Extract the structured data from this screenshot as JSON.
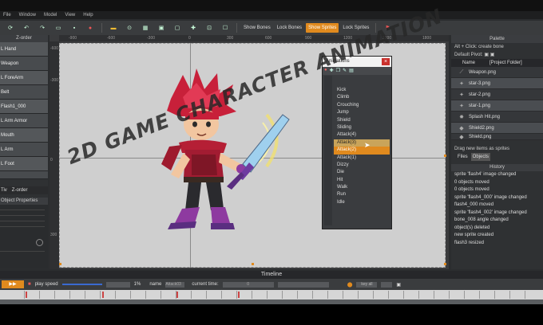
{
  "menubar": [
    "File",
    "Window",
    "Model",
    "View",
    "Help"
  ],
  "toolbar": {
    "show_bones": "Show Bones",
    "lock_bones": "Lock Bones",
    "show_sprites": "Show Sprites",
    "lock_sprites": "Lock Sprites"
  },
  "left_panel": {
    "title": "Z-order",
    "items": [
      "L Hand",
      "Weapon",
      "L ForeArm",
      "Belt",
      "Flash1_000",
      "L Arm Armor",
      "Mouth",
      "L Arm",
      "L Foot",
      ""
    ],
    "tabs": [
      "Tiv",
      "Z-order"
    ],
    "props_title": "Object Properties"
  },
  "ruler": {
    "top": [
      "-900",
      "-600",
      "-300",
      "0",
      "300",
      "600",
      "900",
      "1200",
      "1500",
      "1800"
    ],
    "left": [
      "-600",
      "-300",
      "0",
      "300"
    ]
  },
  "animations": {
    "title": "Animations",
    "items": [
      "Kick",
      "Climb",
      "Crouching",
      "Jump",
      "Shield",
      "Sliding",
      "Attack(4)",
      "Attack(3)",
      "Attack(2)",
      "Attack(1)",
      "Dizzy",
      "Die",
      "Hit",
      "Walk",
      "Run",
      "Idle"
    ]
  },
  "palette": {
    "title": "Palette",
    "hint": "Alt + Click: create bone",
    "default_pivot": "Default Pivot:",
    "col_name": "Name",
    "col_folder": "[Project Folder]",
    "items": [
      "Weapon.png",
      "star-3.png",
      "star-2.png",
      "star-1.png",
      "Splash Hit.png",
      "Shield2.png",
      "Shield.png"
    ],
    "drag_hint": "Drag new items as sprites",
    "tabs": [
      "Files",
      "Objects"
    ]
  },
  "history": {
    "title": "History",
    "items": [
      "sprite 'flash4' image changed",
      "0 objects moved",
      "0 objects moved",
      "sprite 'flash4_000' image changed",
      "flash4_000 moved",
      "sprite 'flash4_002' image changed",
      "bone_008 angle changed",
      "object(s) deleted",
      "new sprite created",
      "flash3 resized"
    ]
  },
  "timeline": {
    "title": "Timeline",
    "play_speed_label": "play speed",
    "speed_value": "1%",
    "name_label": "name",
    "name_value": "Attack03",
    "current_time_label": "current time:",
    "current_time_value": "0",
    "key_all": "key all"
  },
  "watermark": "2D GAME CHARACTER ANIMATION",
  "colors": {
    "accent": "#e08a1e",
    "stage": "#cfcfcf",
    "panel": "#2f3133"
  }
}
